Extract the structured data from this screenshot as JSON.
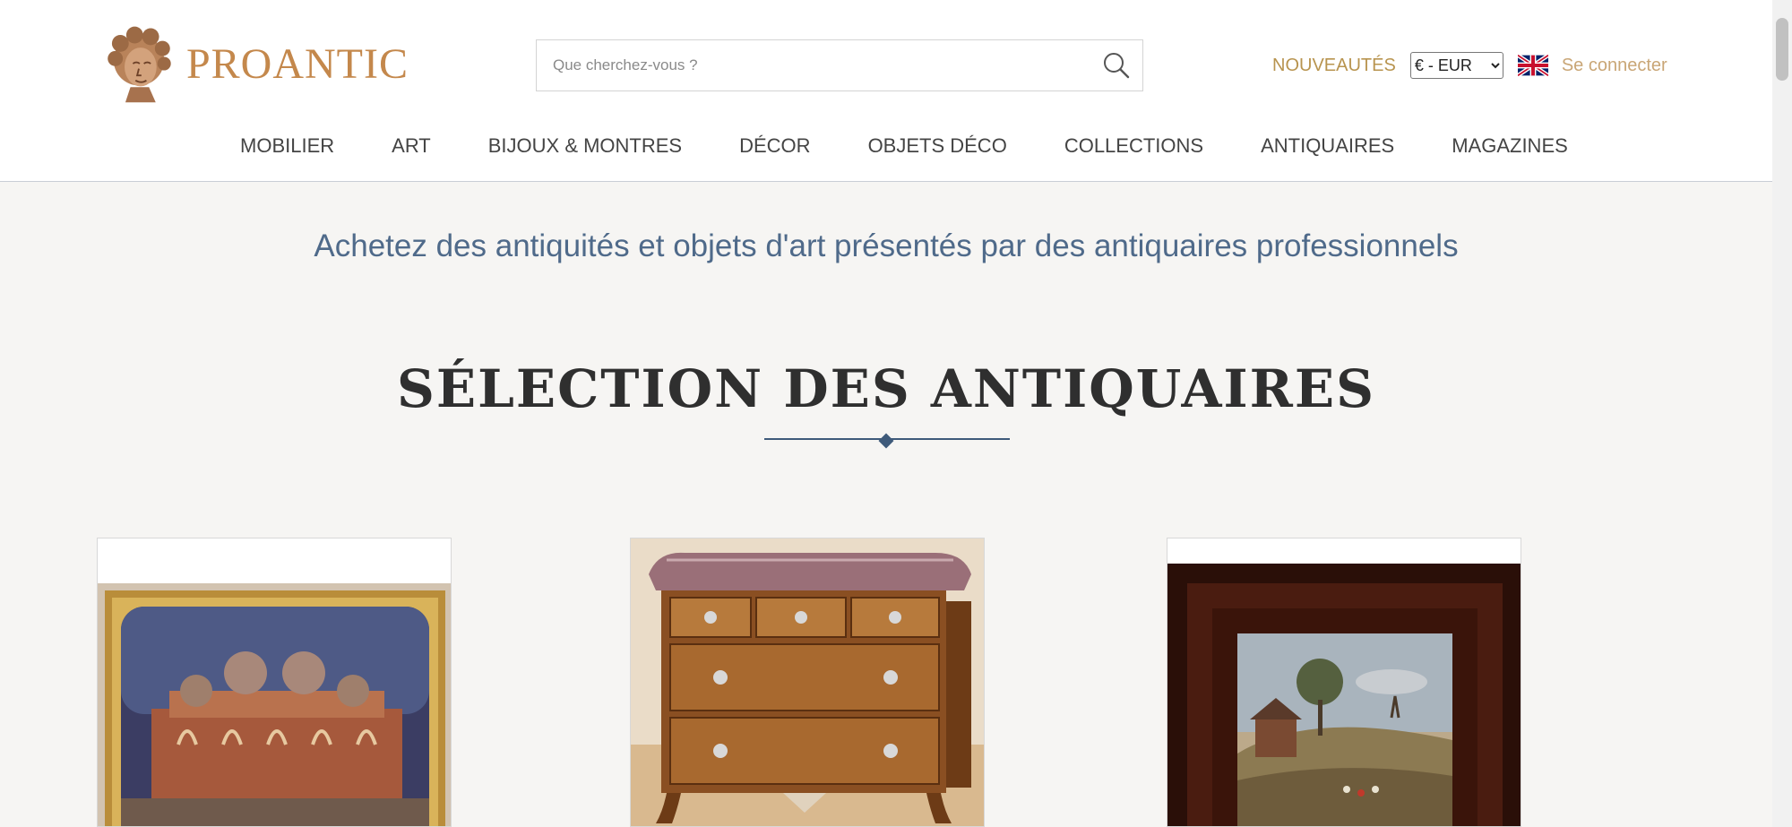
{
  "brand": {
    "name": "PROANTIC"
  },
  "search": {
    "placeholder": "Que cherchez-vous ?"
  },
  "topbar": {
    "new_label": "NOUVEAUTÉS",
    "currency_selected": "€ - EUR",
    "login_label": "Se connecter"
  },
  "nav": {
    "items": [
      {
        "label": "MOBILIER"
      },
      {
        "label": "ART"
      },
      {
        "label": "BIJOUX & MONTRES"
      },
      {
        "label": "DÉCOR"
      },
      {
        "label": "OBJETS DÉCO"
      },
      {
        "label": "COLLECTIONS"
      },
      {
        "label": "ANTIQUAIRES"
      },
      {
        "label": "MAGAZINES"
      }
    ]
  },
  "main": {
    "tagline": "Achetez des antiquités et objets d'art présentés par des antiquaires professionnels",
    "section_title": "SÉLECTION DES ANTIQUAIRES"
  },
  "icons": {
    "search": "search-icon",
    "flag": "uk-flag-icon",
    "logo": "logo-head-icon"
  },
  "colors": {
    "brand": "#c4884c",
    "accent_gold": "#b8944f",
    "tagline_blue": "#4f6a8a",
    "underline": "#3e5a7a",
    "background": "#f6f5f3"
  }
}
